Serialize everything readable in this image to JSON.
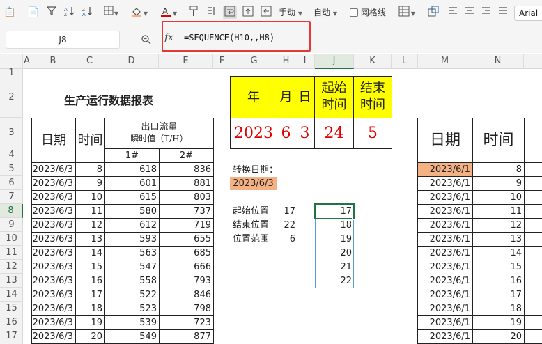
{
  "toolbar": {
    "manual_label": "手动",
    "auto_label": "自动",
    "gridlines_label": "网格线",
    "font_name": "Arial"
  },
  "formula_bar": {
    "cell_ref": "J8",
    "fx_label": "fx",
    "formula": "=SEQUENCE(H10,,H8)"
  },
  "columns": [
    "A",
    "B",
    "C",
    "D",
    "E",
    "F",
    "G",
    "H",
    "I",
    "J",
    "K",
    "L",
    "M",
    "N"
  ],
  "rows": [
    "1",
    "2",
    "3",
    "4",
    "5",
    "6",
    "7",
    "8",
    "9",
    "10",
    "11",
    "12",
    "13",
    "14",
    "15",
    "16",
    "17"
  ],
  "report": {
    "title": "生产运行数据报表",
    "date_header": "日期",
    "time_header": "时间",
    "flow_header_line1": "出口流量",
    "flow_header_line2": "瞬时值（T/H）",
    "sub1": "1#",
    "sub2": "2#",
    "rows": [
      {
        "date": "2023/6/3",
        "time": "8",
        "v1": "618",
        "v2": "836"
      },
      {
        "date": "2023/6/3",
        "time": "9",
        "v1": "601",
        "v2": "881"
      },
      {
        "date": "2023/6/3",
        "time": "10",
        "v1": "615",
        "v2": "803"
      },
      {
        "date": "2023/6/3",
        "time": "11",
        "v1": "580",
        "v2": "737"
      },
      {
        "date": "2023/6/3",
        "time": "12",
        "v1": "612",
        "v2": "719"
      },
      {
        "date": "2023/6/3",
        "time": "13",
        "v1": "593",
        "v2": "655"
      },
      {
        "date": "2023/6/3",
        "time": "14",
        "v1": "563",
        "v2": "685"
      },
      {
        "date": "2023/6/3",
        "time": "15",
        "v1": "547",
        "v2": "666"
      },
      {
        "date": "2023/6/3",
        "time": "16",
        "v1": "558",
        "v2": "793"
      },
      {
        "date": "2023/6/3",
        "time": "17",
        "v1": "522",
        "v2": "846"
      },
      {
        "date": "2023/6/3",
        "time": "18",
        "v1": "523",
        "v2": "798"
      },
      {
        "date": "2023/6/3",
        "time": "19",
        "v1": "539",
        "v2": "723"
      },
      {
        "date": "2023/6/3",
        "time": "20",
        "v1": "549",
        "v2": "877"
      }
    ]
  },
  "params": {
    "headers": [
      "年",
      "月",
      "日",
      "起始\n时间",
      "结束\n时间"
    ],
    "values": [
      "2023",
      "6",
      "3",
      "24",
      "5"
    ],
    "convert_label": "转换日期：",
    "convert_value": "2023/6/3",
    "start_label": "起始位置",
    "start_value": "17",
    "end_label": "结束位置",
    "end_value": "22",
    "range_label": "位置范围",
    "range_value": "6",
    "sequence": [
      "17",
      "18",
      "19",
      "20",
      "21",
      "22"
    ]
  },
  "right_table": {
    "date_header": "日期",
    "time_header": "时间",
    "rows": [
      {
        "date": "2023/6/1",
        "time": "8"
      },
      {
        "date": "2023/6/1",
        "time": "9"
      },
      {
        "date": "2023/6/1",
        "time": "10"
      },
      {
        "date": "2023/6/1",
        "time": "11"
      },
      {
        "date": "2023/6/1",
        "time": "12"
      },
      {
        "date": "2023/6/1",
        "time": "13"
      },
      {
        "date": "2023/6/1",
        "time": "14"
      },
      {
        "date": "2023/6/1",
        "time": "15"
      },
      {
        "date": "2023/6/1",
        "time": "16"
      },
      {
        "date": "2023/6/1",
        "time": "17"
      },
      {
        "date": "2023/6/1",
        "time": "18"
      },
      {
        "date": "2023/6/1",
        "time": "19"
      },
      {
        "date": "2023/6/1",
        "time": "20"
      }
    ]
  },
  "colors": {
    "accent_green": "#217346",
    "highlight_red": "#e53935",
    "param_yellow": "#ffff00",
    "cell_orange": "#f4b183",
    "value_red": "#e00000",
    "sequence_border": "#5b9bd5"
  }
}
